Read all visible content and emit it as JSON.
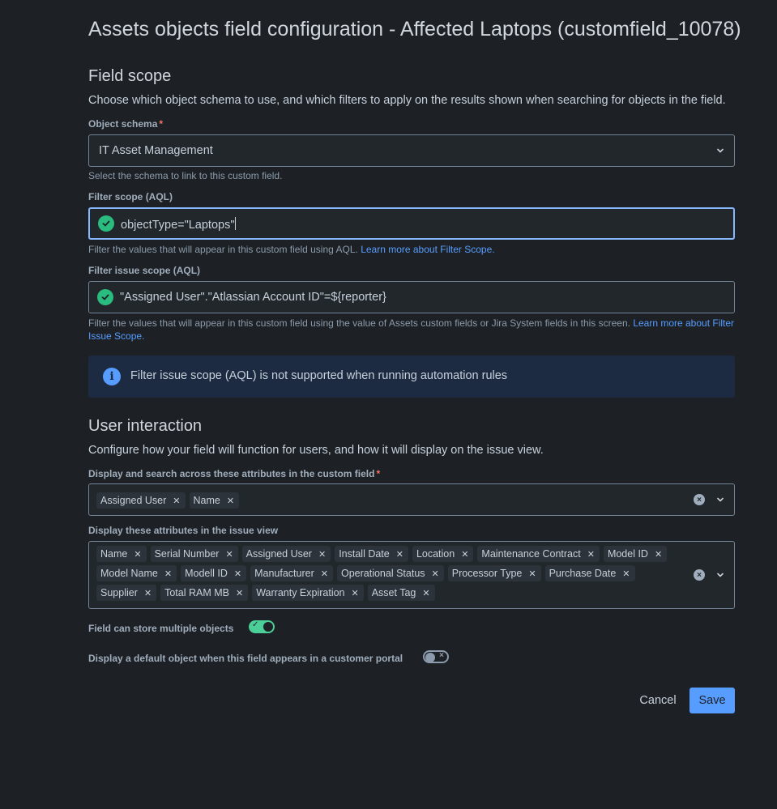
{
  "dialog": {
    "title": "Assets objects field configuration - Affected Laptops (customfield_10078)"
  },
  "field_scope": {
    "heading": "Field scope",
    "description": "Choose which object schema to use, and which filters to apply on the results shown when searching for objects in the field.",
    "object_schema": {
      "label": "Object schema",
      "required_marker": "*",
      "value": "IT Asset Management",
      "help": "Select the schema to link to this custom field."
    },
    "filter_scope": {
      "label": "Filter scope (AQL)",
      "value": "objectType=\"Laptops\"",
      "help": "Filter the values that will appear in this custom field using AQL.",
      "help_link": "Learn more about Filter Scope."
    },
    "filter_issue_scope": {
      "label": "Filter issue scope (AQL)",
      "value": "\"Assigned User\".\"Atlassian Account ID\"=${reporter}",
      "help": "Filter the values that will appear in this custom field using the value of Assets custom fields or Jira System fields in this screen.",
      "help_link": "Learn more about Filter Issue Scope."
    },
    "info_banner": "Filter issue scope (AQL) is not supported when running automation rules"
  },
  "user_interaction": {
    "heading": "User interaction",
    "description": "Configure how your field will function for users, and how it will display on the issue view.",
    "search_attributes": {
      "label": "Display and search across these attributes in the custom field",
      "required_marker": "*",
      "tags": [
        "Assigned User",
        "Name"
      ]
    },
    "issue_view_attributes": {
      "label": "Display these attributes in the issue view",
      "tags": [
        "Name",
        "Serial Number",
        "Assigned User",
        "Install Date",
        "Location",
        "Maintenance Contract",
        "Model ID",
        "Model Name",
        "Modell ID",
        "Manufacturer",
        "Operational Status",
        "Processor Type",
        "Purchase Date",
        "Supplier",
        "Total RAM MB",
        "Warranty Expiration",
        "Asset Tag"
      ]
    },
    "multiple_objects": {
      "label": "Field can store multiple objects",
      "enabled": true
    },
    "default_object": {
      "label": "Display a default object when this field appears in a customer portal",
      "enabled": false
    }
  },
  "actions": {
    "cancel_label": "Cancel",
    "save_label": "Save"
  },
  "colors": {
    "background": "#1d2125",
    "accent": "#579dff",
    "success": "#2abb7f",
    "toggle_on": "#4bce97"
  }
}
